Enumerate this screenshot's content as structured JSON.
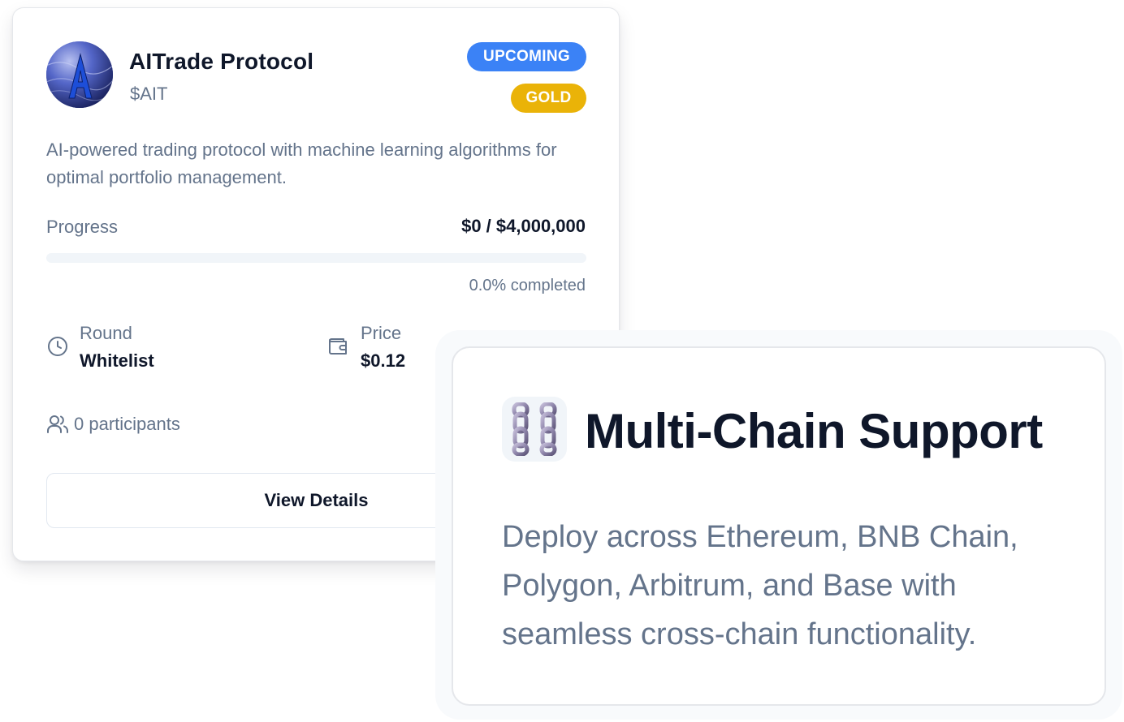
{
  "project": {
    "name": "AITrade Protocol",
    "ticker": "$AIT",
    "avatar_icon": "aitrade-logo",
    "status_badge": "UPCOMING",
    "tier_badge": "GOLD",
    "description": "AI-powered trading protocol with machine learning algorithms for optimal portfolio management.",
    "progress": {
      "label": "Progress",
      "raised_text": "$0 / $4,000,000",
      "percent": 0.0,
      "percent_text": "0.0% completed"
    },
    "round": {
      "label": "Round",
      "value": "Whitelist",
      "icon": "clock-icon"
    },
    "price": {
      "label": "Price",
      "value": "$0.12",
      "icon": "wallet-icon"
    },
    "participants_text": "0 participants",
    "details_button": "View Details"
  },
  "feature": {
    "icon": "chain-link-icon",
    "title": "Multi-Chain Support",
    "description": "Deploy across Ethereum, BNB Chain, Polygon, Arbitrum, and Base with seamless cross-chain functionality."
  },
  "colors": {
    "status_badge": "#3b82f6",
    "tier_badge": "#eab308",
    "text_primary": "#0f172a",
    "text_muted": "#64748b",
    "progress_track": "#f1f5f9",
    "card_border": "#e5e7eb"
  }
}
